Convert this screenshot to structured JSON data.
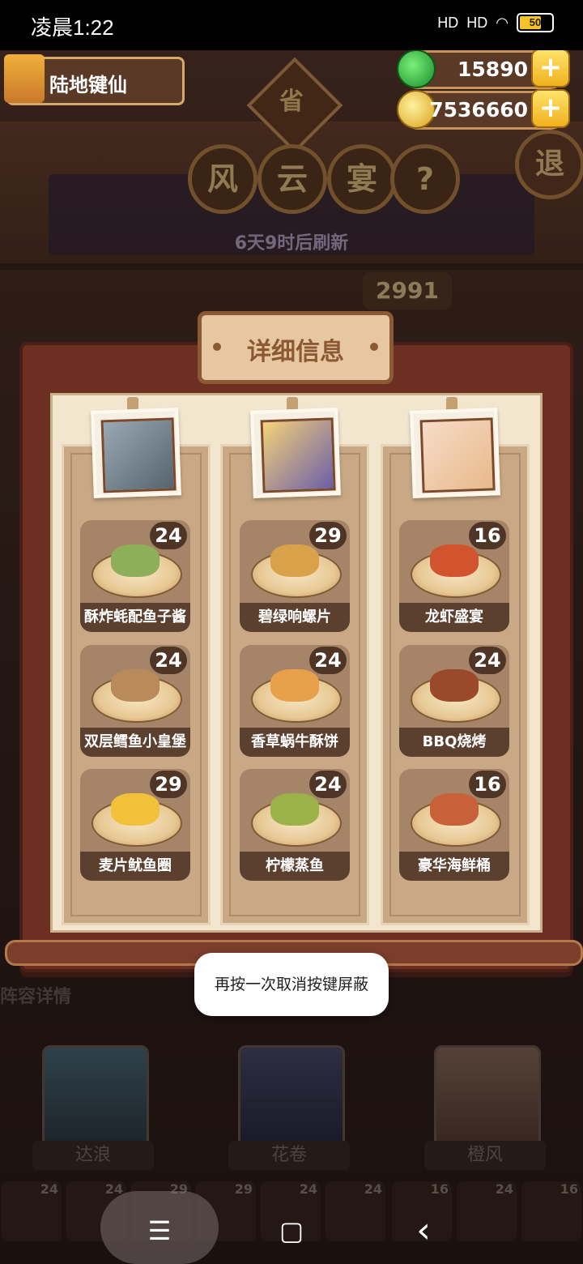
{
  "status_bar": {
    "time": "凌晨1:22",
    "signal1": "HD",
    "signal2": "HD",
    "battery": "50"
  },
  "player": {
    "name": "陆地键仙"
  },
  "resources": {
    "gems": "15890",
    "coins": "7536660"
  },
  "header": {
    "sign": "省",
    "title_chars": [
      "风",
      "云",
      "宴"
    ],
    "help": "?",
    "exit": "退",
    "refresh_text": "6天9时后刷新",
    "score": "2991"
  },
  "panel": {
    "title": "详细信息",
    "columns": [
      {
        "dishes": [
          {
            "name": "酥炸蚝配鱼子酱",
            "count": "24",
            "color": "#8fae5a"
          },
          {
            "name": "双层鳕鱼小皇堡",
            "count": "24",
            "color": "#b98a5a"
          },
          {
            "name": "麦片鱿鱼圈",
            "count": "29",
            "color": "#f2c13a"
          }
        ]
      },
      {
        "dishes": [
          {
            "name": "碧绿响螺片",
            "count": "29",
            "color": "#d9a24a"
          },
          {
            "name": "香草蜗牛酥饼",
            "count": "24",
            "color": "#e9a04a"
          },
          {
            "name": "柠檬蒸鱼",
            "count": "24",
            "color": "#9bb24a"
          }
        ]
      },
      {
        "dishes": [
          {
            "name": "龙虾盛宴",
            "count": "16",
            "color": "#d2542e"
          },
          {
            "name": "BBQ烧烤",
            "count": "24",
            "color": "#9a4a2a"
          },
          {
            "name": "豪华海鲜桶",
            "count": "16",
            "color": "#c8613a"
          }
        ]
      }
    ]
  },
  "lower": {
    "section_label": "阵容详情",
    "heroes": [
      "达浪",
      "花卷",
      "橙风"
    ],
    "small_counts": [
      "24",
      "24",
      "29",
      "29",
      "24",
      "24",
      "16",
      "24",
      "16"
    ]
  },
  "toast": {
    "text": "再按一次取消按键屏蔽"
  },
  "nav": {
    "menu": "☰",
    "home": "▢",
    "back": "‹"
  }
}
